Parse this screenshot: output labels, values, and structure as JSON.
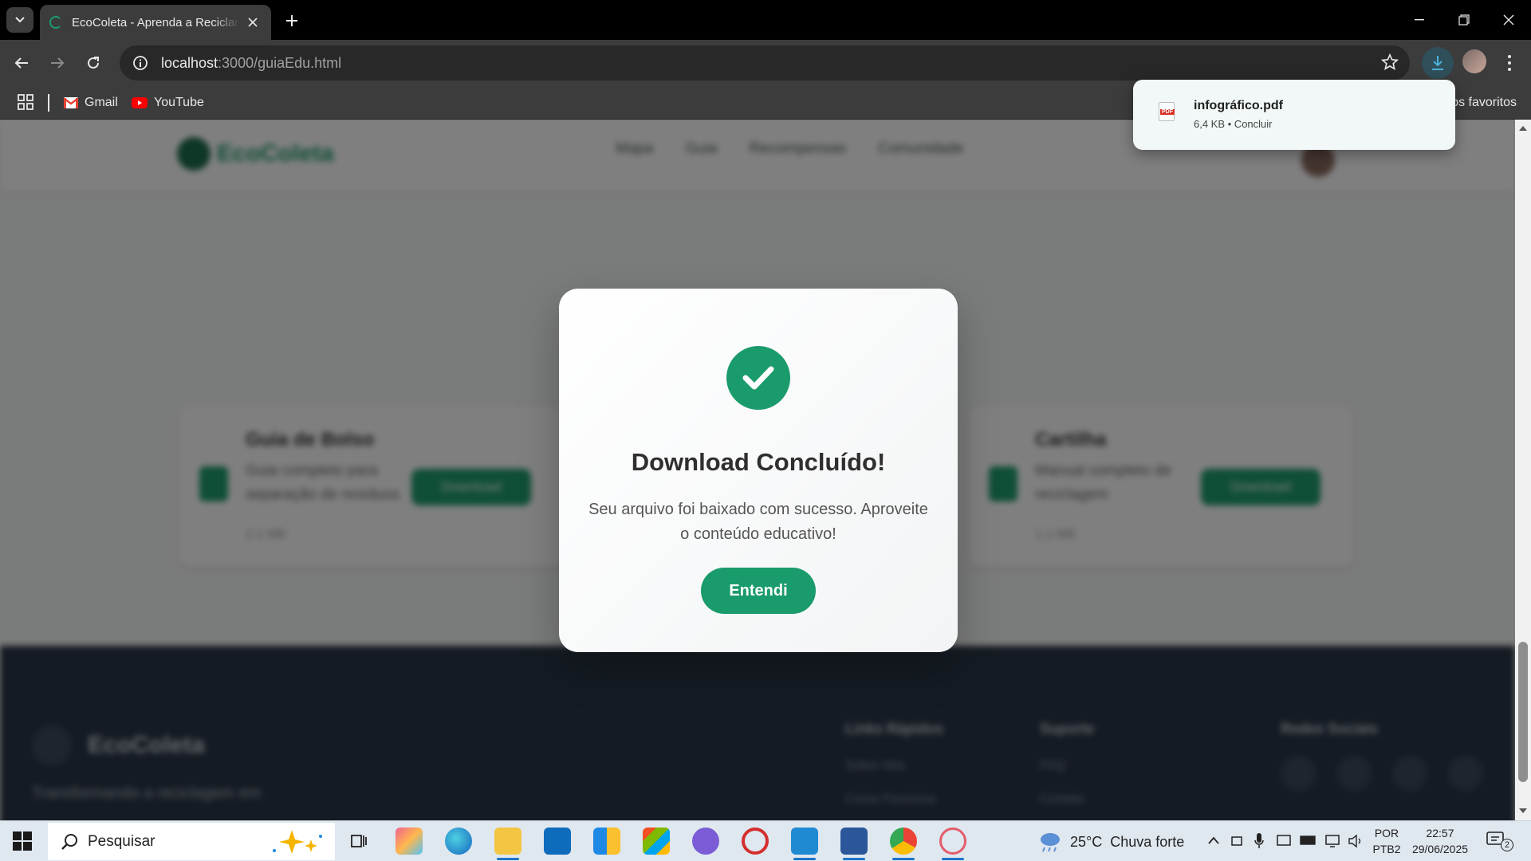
{
  "browser": {
    "tab_title": "EcoColeta - Aprenda a Reciclar e",
    "url_host": "localhost",
    "url_path": ":3000/guiaEdu.html",
    "bookmarks": [
      {
        "label": "Gmail"
      },
      {
        "label": "YouTube"
      }
    ],
    "bookmarks_right": "os favoritos"
  },
  "download": {
    "filename": "infográfico.pdf",
    "meta": "6,4 KB • Concluir",
    "icon_label": "PDF"
  },
  "page": {
    "logo": "EcoColeta",
    "nav": [
      "Mapa",
      "Guia",
      "Recompensas",
      "Comunidade"
    ],
    "cards": [
      {
        "title": "Guia de Bolso",
        "desc": "Guia completo para separação de resíduos",
        "button": "Download",
        "size": "2.1 MB"
      },
      {
        "title": "Cartilha",
        "desc": "Manual completo de reciclagem",
        "button": "Download",
        "size": "1.1 MB"
      }
    ],
    "footer": {
      "brand": "EcoColeta",
      "desc": "Transformando a reciclagem em",
      "columns": [
        "Links Rápidos",
        "Suporte",
        "Redes Sociais"
      ],
      "links_a": [
        "Sobre Nós",
        "Como Funciona"
      ],
      "links_b": [
        "FAQ",
        "Contato"
      ]
    }
  },
  "modal": {
    "title": "Download Concluído!",
    "message": "Seu arquivo foi baixado com sucesso. Aproveite o conteúdo educativo!",
    "button": "Entendi",
    "accent": "#1a9b6b"
  },
  "taskbar": {
    "search": "Pesquisar",
    "weather_temp": "25°C",
    "weather_desc": "Chuva forte",
    "lang": "POR",
    "layout": "PTB2",
    "time": "22:57",
    "date": "29/06/2025",
    "notifications": "2"
  }
}
